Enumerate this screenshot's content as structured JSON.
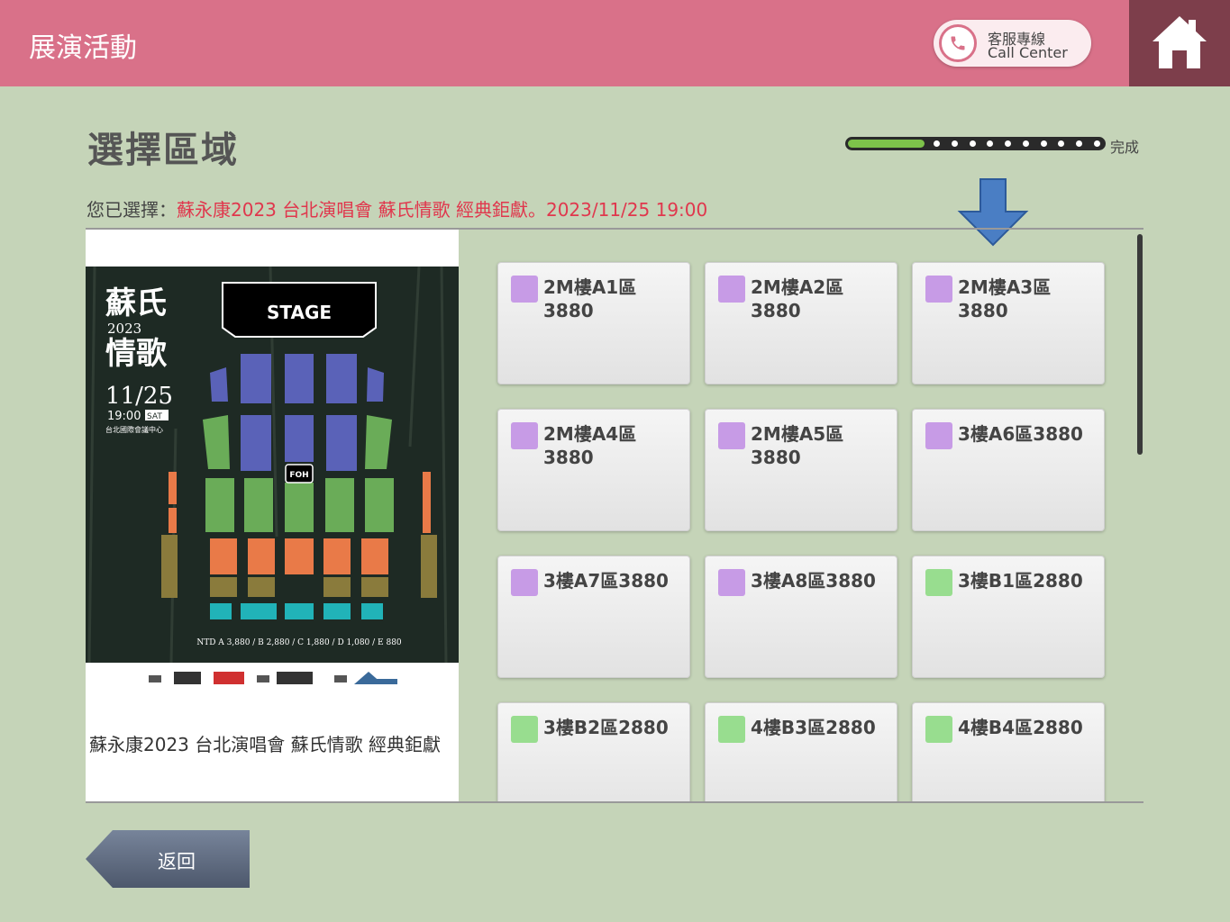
{
  "header": {
    "app_title": "展演活動",
    "call_center_line1": "客服專線",
    "call_center_line2": "Call Center"
  },
  "page": {
    "title": "選擇區域",
    "progress_end_label": "完成",
    "progress_fraction": 0.3
  },
  "selection": {
    "label": "您已選擇：",
    "value": "蘇永康2023 台北演唱會 蘇氏情歌 經典鉅獻。2023/11/25 19:00"
  },
  "poster": {
    "stage_label": "STAGE",
    "foh_label": "FOH",
    "title_line1": "蘇氏",
    "title_line2": "情歌",
    "year_text": "2023",
    "date_text": "11/25",
    "time_text": "19:00",
    "day_text": "SAT",
    "venue_text": "台北國際會議中心",
    "price_text": "NTD A 3,880 / B 2,880 / C 1,880 / D 1,080 / E 880",
    "caption": "蘇永康2023 台北演唱會 蘇氏情歌 經典鉅獻"
  },
  "zones": [
    {
      "name": "2M樓A1區",
      "price": "3880",
      "color": "#c79be6"
    },
    {
      "name": "2M樓A2區",
      "price": "3880",
      "color": "#c79be6"
    },
    {
      "name": "2M樓A3區",
      "price": "3880",
      "color": "#c79be6"
    },
    {
      "name": "2M樓A4區",
      "price": "3880",
      "color": "#c79be6"
    },
    {
      "name": "2M樓A5區",
      "price": "3880",
      "color": "#c79be6"
    },
    {
      "name": "3樓A6區3880",
      "price": "",
      "color": "#c79be6"
    },
    {
      "name": "3樓A7區3880",
      "price": "",
      "color": "#c79be6"
    },
    {
      "name": "3樓A8區3880",
      "price": "",
      "color": "#c79be6"
    },
    {
      "name": "3樓B1區2880",
      "price": "",
      "color": "#98dd8f"
    },
    {
      "name": "3樓B2區2880",
      "price": "",
      "color": "#98dd8f"
    },
    {
      "name": "4樓B3區2880",
      "price": "",
      "color": "#98dd8f"
    },
    {
      "name": "4樓B4區2880",
      "price": "",
      "color": "#98dd8f"
    }
  ],
  "footer": {
    "back_label": "返回"
  },
  "colors": {
    "header_bg": "#d97189",
    "home_bg": "#7d3e4b",
    "page_bg": "#c5d4b8",
    "accent_red": "#e0374d",
    "zone_a": "#c79be6",
    "zone_b": "#98dd8f",
    "arrow_blue": "#4a7ec4"
  }
}
